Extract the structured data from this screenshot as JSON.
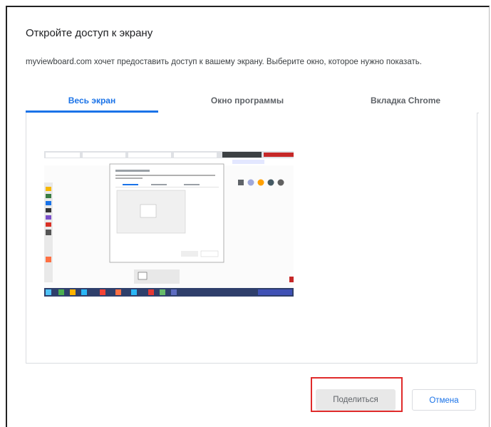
{
  "dialog": {
    "title": "Откройте доступ к экрану",
    "description": "myviewboard.com хочет предоставить доступ к вашему экрану. Выберите окно, которое нужно показать."
  },
  "tabs": [
    {
      "label": "Весь экран",
      "active": true
    },
    {
      "label": "Окно программы",
      "active": false
    },
    {
      "label": "Вкладка Chrome",
      "active": false
    }
  ],
  "buttons": {
    "share_label": "Поделиться",
    "cancel_label": "Отмена"
  },
  "colors": {
    "accent": "#1a73e8",
    "highlight": "#e02b2b"
  }
}
